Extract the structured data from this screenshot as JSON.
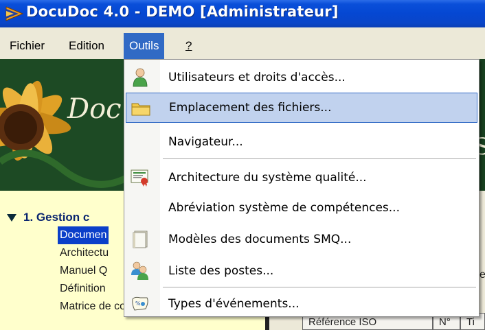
{
  "window": {
    "title": "DocuDoc 4.0 - DEMO [Administrateur]"
  },
  "menubar": {
    "items": [
      {
        "label": "Fichier"
      },
      {
        "label": "Edition"
      },
      {
        "label": "Outils"
      },
      {
        "label": "?"
      }
    ]
  },
  "banner": {
    "text": "Doc",
    "right_fragment": "S"
  },
  "tree": {
    "section_label": "1. Gestion c",
    "items": [
      {
        "label": "Documen"
      },
      {
        "label": "Architectu"
      },
      {
        "label": "Manuel Q"
      },
      {
        "label": "Définition"
      },
      {
        "label": "Matrice de corrélation"
      }
    ]
  },
  "right_panel": {
    "fragment_et": "et",
    "fragment_ti": "Ti",
    "column_reference": "Référence ISO",
    "column_n": "N°"
  },
  "tools_menu": {
    "items": [
      {
        "label": "Utilisateurs et droits d'accès...",
        "icon": "user-icon"
      },
      {
        "label": "Emplacement des fichiers...",
        "icon": "folder-icon"
      },
      {
        "label": "Navigateur...",
        "icon": ""
      },
      {
        "label": "Architecture du système qualité...",
        "icon": "certificate-icon"
      },
      {
        "label": "Abréviation système de compétences...",
        "icon": ""
      },
      {
        "label": "Modèles des documents SMQ...",
        "icon": "document-template-icon"
      },
      {
        "label": "Liste des postes...",
        "icon": "users-group-icon"
      },
      {
        "label": "Types d'événements...",
        "icon": "event-types-icon"
      }
    ],
    "highlighted_item": "Emplacement des fichiers..."
  },
  "colors": {
    "titlebar_blue": "#0547d2",
    "menu_highlight": "#316ac5",
    "hover_fill": "#c1d2ee",
    "tree_background": "#ffffcc",
    "tree_selected": "#0b3fc9",
    "section_text": "#0a2570",
    "banner_green": "#17401f"
  }
}
